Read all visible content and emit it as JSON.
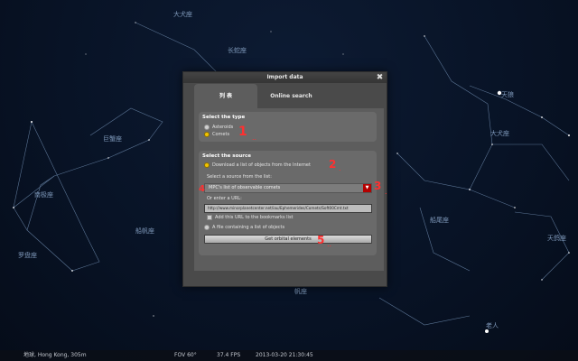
{
  "sky": {
    "labels": [
      {
        "id": "lbl-1",
        "text": "大犬座"
      },
      {
        "id": "lbl-2",
        "text": "天狼"
      },
      {
        "id": "lbl-3",
        "text": "长蛇座"
      },
      {
        "id": "lbl-4",
        "text": "巨蟹座"
      },
      {
        "id": "lbl-5",
        "text": "船尾座"
      },
      {
        "id": "lbl-6",
        "text": "大犬座"
      },
      {
        "id": "lbl-7",
        "text": "天鸽座"
      },
      {
        "id": "lbl-8",
        "text": "老人"
      },
      {
        "id": "lbl-9",
        "text": "南极座"
      },
      {
        "id": "lbl-10",
        "text": "帆座"
      },
      {
        "id": "lbl-11",
        "text": "船帆座"
      },
      {
        "id": "lbl-12",
        "text": "罗盘座"
      }
    ]
  },
  "status_bar": {
    "location": "地球, Hong Kong, 305m",
    "fov": "FOV 60°",
    "fps": "37.4 FPS",
    "datetime": "2013-03-20  21:30:45"
  },
  "dialog": {
    "title": "Import data",
    "close_glyph": "✖",
    "tabs": [
      {
        "label": "列 表",
        "active": true
      },
      {
        "label": "Online search",
        "active": false
      }
    ],
    "type_section": {
      "title": "Select the type",
      "options": [
        {
          "label": "Asteroids",
          "selected": false
        },
        {
          "label": "Comets",
          "selected": true
        }
      ]
    },
    "source_section": {
      "title": "Select the source",
      "download_option": "Download a list of objects from the Internet",
      "list_label": "Select a source from the list:",
      "combo_value": "MPC's list of observable comets",
      "url_option": "Or enter a URL:",
      "url_value": "http://www.minorplanetcenter.net/iau/Ephemerides/Comets/Soft00Cmt.txt",
      "bookmark_option": "Add this URL to the bookmarks list",
      "file_option": "A file containing a list of objects",
      "get_button": "Get orbital elements"
    }
  },
  "annotations": [
    "1",
    "2",
    "3",
    "4",
    "5"
  ],
  "colors": {
    "annotation": "#ff3030",
    "radio_selected": "#f2c400",
    "combo_arrow": "#b40000"
  }
}
